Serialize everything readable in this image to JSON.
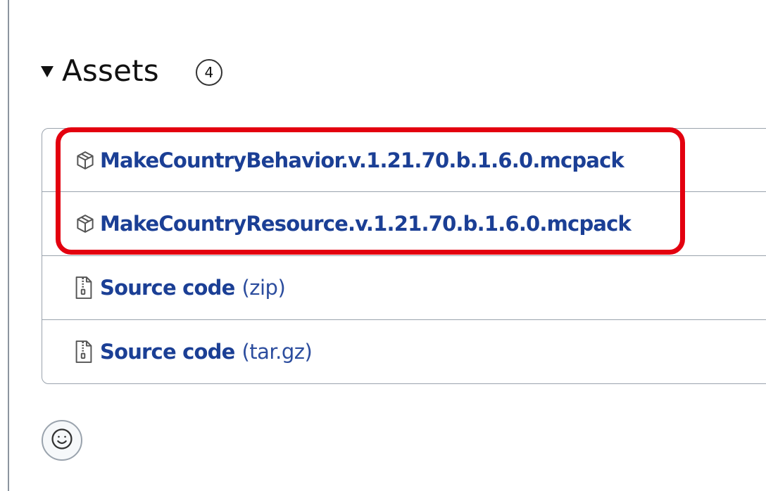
{
  "assets": {
    "title": "Assets",
    "count": "4",
    "items": [
      {
        "name": "MakeCountryBehavior.v.1.21.70.b.1.6.0.mcpack",
        "suffix": "",
        "icon": "package-icon"
      },
      {
        "name": "MakeCountryResource.v.1.21.70.b.1.6.0.mcpack",
        "suffix": "",
        "icon": "package-icon"
      },
      {
        "name": "Source code",
        "suffix": "(zip)",
        "icon": "file-zip-icon"
      },
      {
        "name": "Source code",
        "suffix": "(tar.gz)",
        "icon": "file-zip-icon"
      }
    ]
  },
  "reaction": {
    "icon": "smiley-icon"
  },
  "colors": {
    "link": "#1b3f95",
    "highlight": "#e3000f",
    "border": "#9aa3ad"
  }
}
